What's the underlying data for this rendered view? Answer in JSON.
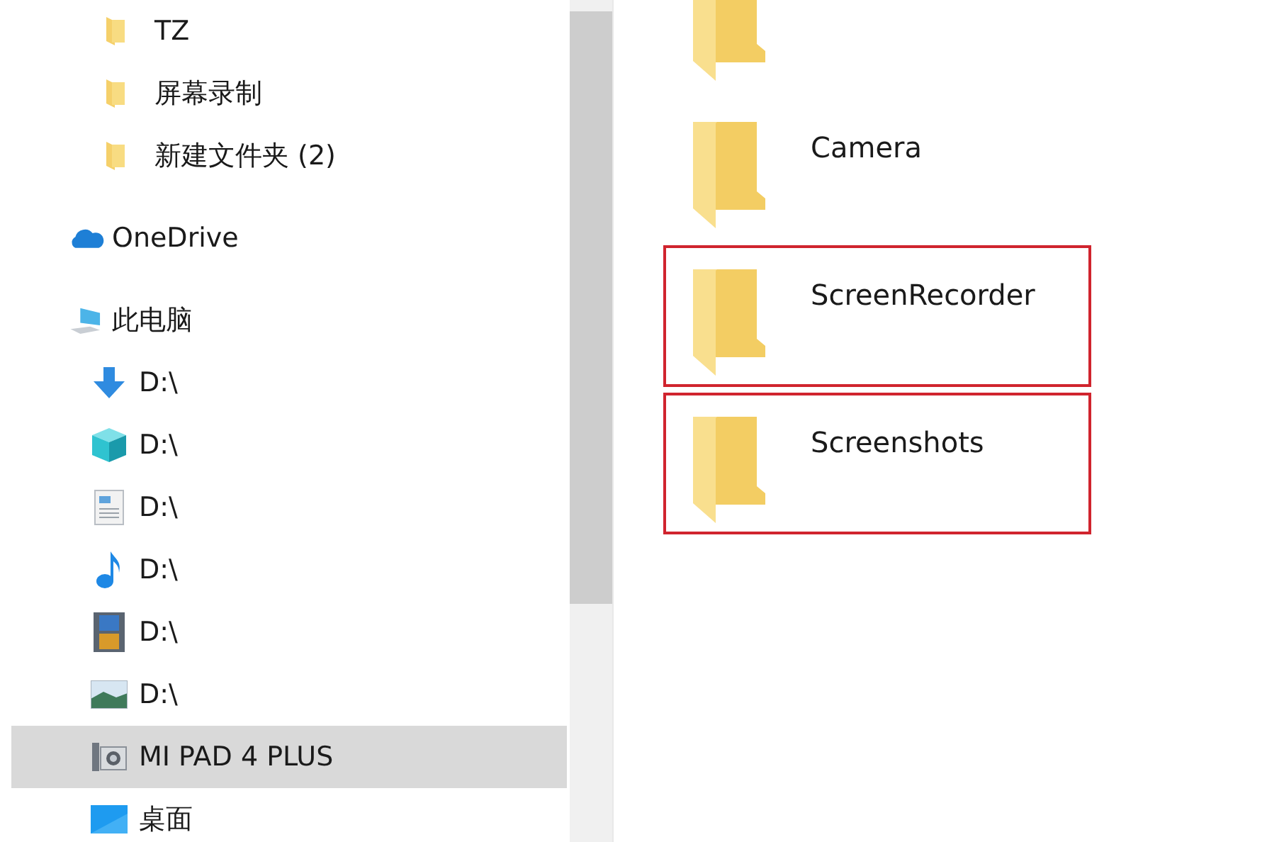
{
  "navigation": {
    "folders": [
      {
        "label": "TZ",
        "kind": "folder",
        "selected": false
      },
      {
        "label": "屏幕录制",
        "kind": "folder",
        "selected": false
      },
      {
        "label": "新建文件夹 (2)",
        "kind": "folder",
        "selected": false
      }
    ],
    "onedrive": {
      "label": "OneDrive",
      "kind": "cloud",
      "selected": false
    },
    "this_pc": {
      "label": "此电脑",
      "kind": "computer",
      "selected": false,
      "children": [
        {
          "label": "D:\\",
          "kind": "downloads",
          "selected": false
        },
        {
          "label": "D:\\",
          "kind": "objects3d",
          "selected": false
        },
        {
          "label": "D:\\",
          "kind": "documents",
          "selected": false
        },
        {
          "label": "D:\\",
          "kind": "music",
          "selected": false
        },
        {
          "label": "D:\\",
          "kind": "videos",
          "selected": false
        },
        {
          "label": "D:\\",
          "kind": "pictures",
          "selected": false
        },
        {
          "label": "MI PAD 4 PLUS",
          "kind": "device",
          "selected": true
        },
        {
          "label": "桌面",
          "kind": "desktop",
          "selected": false
        }
      ]
    }
  },
  "files": [
    {
      "kind": "folder",
      "highlighted": false
    },
    {
      "label": "Camera",
      "kind": "folder",
      "highlighted": false
    },
    {
      "label": "ScreenRecorder",
      "kind": "folder",
      "highlighted": true
    },
    {
      "label": "Screenshots",
      "kind": "folder",
      "highlighted": true
    }
  ]
}
